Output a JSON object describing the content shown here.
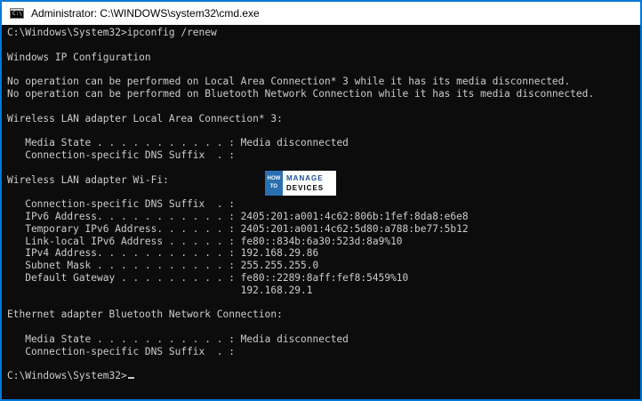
{
  "window": {
    "title": "Administrator: C:\\WINDOWS\\system32\\cmd.exe",
    "icon": "cmd-icon",
    "border_color": "#0078d7"
  },
  "console": {
    "lines": [
      "C:\\Windows\\System32>ipconfig /renew",
      "",
      "Windows IP Configuration",
      "",
      "No operation can be performed on Local Area Connection* 3 while it has its media disconnected.",
      "No operation can be performed on Bluetooth Network Connection while it has its media disconnected.",
      "",
      "Wireless LAN adapter Local Area Connection* 3:",
      "",
      "   Media State . . . . . . . . . . . : Media disconnected",
      "   Connection-specific DNS Suffix  . :",
      "",
      "Wireless LAN adapter Wi-Fi:",
      "",
      "   Connection-specific DNS Suffix  . :",
      "   IPv6 Address. . . . . . . . . . . : 2405:201:a001:4c62:806b:1fef:8da8:e6e8",
      "   Temporary IPv6 Address. . . . . . : 2405:201:a001:4c62:5d80:a788:be77:5b12",
      "   Link-local IPv6 Address . . . . . : fe80::834b:6a30:523d:8a9%10",
      "   IPv4 Address. . . . . . . . . . . : 192.168.29.86",
      "   Subnet Mask . . . . . . . . . . . : 255.255.255.0",
      "   Default Gateway . . . . . . . . . : fe80::2289:8aff:fef8:5459%10",
      "                                       192.168.29.1",
      "",
      "Ethernet adapter Bluetooth Network Connection:",
      "",
      "   Media State . . . . . . . . . . . : Media disconnected",
      "   Connection-specific DNS Suffix  . :",
      "",
      "C:\\Windows\\System32>"
    ],
    "text_color": "#cccccc",
    "background": "#0c0c0c"
  },
  "watermark": {
    "how": "HOW",
    "to": "TO",
    "manage": "MANAGE",
    "devices": "DEVICES"
  }
}
